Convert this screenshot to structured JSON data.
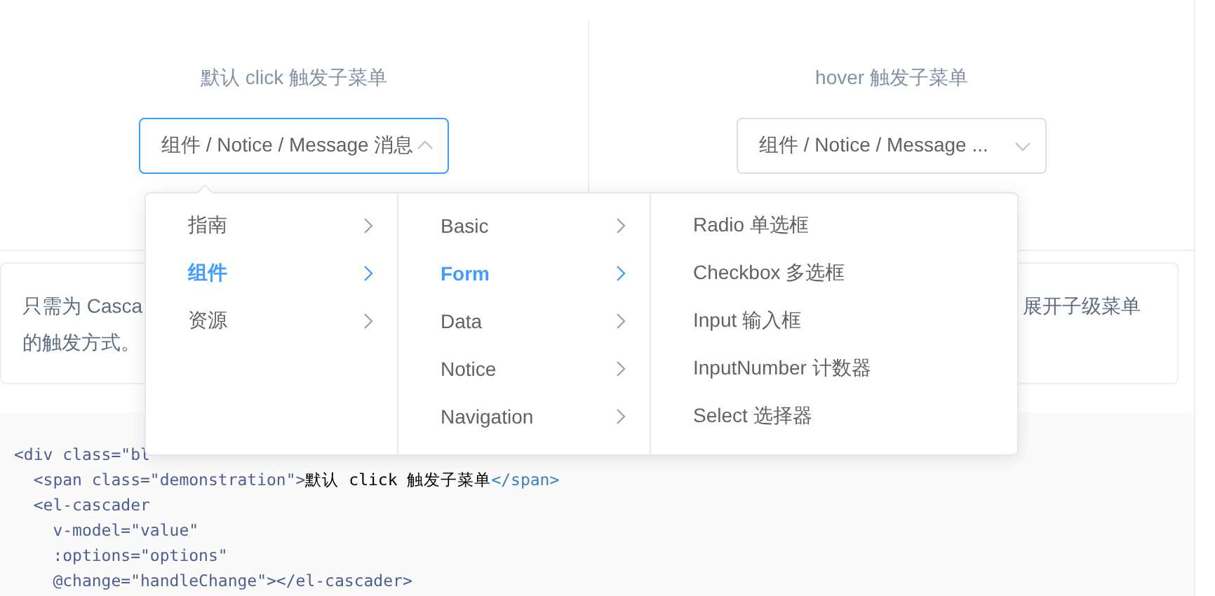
{
  "demos": [
    {
      "label": "默认 click 触发子菜单",
      "value": "组件 / Notice / Message 消息",
      "focused": true,
      "expanded": true
    },
    {
      "label": "hover 触发子菜单",
      "value": "组件 / Notice / Message ...",
      "focused": false,
      "expanded": false
    }
  ],
  "menu": {
    "columns": [
      [
        {
          "label": "指南",
          "selected": false,
          "has_children": true
        },
        {
          "label": "组件",
          "selected": true,
          "has_children": true
        },
        {
          "label": "资源",
          "selected": false,
          "has_children": true
        }
      ],
      [
        {
          "label": "Basic",
          "selected": false,
          "has_children": true
        },
        {
          "label": "Form",
          "selected": true,
          "has_children": true
        },
        {
          "label": "Data",
          "selected": false,
          "has_children": true
        },
        {
          "label": "Notice",
          "selected": false,
          "has_children": true
        },
        {
          "label": "Navigation",
          "selected": false,
          "has_children": true
        }
      ],
      [
        {
          "label": "Radio 单选框",
          "selected": false,
          "has_children": false
        },
        {
          "label": "Checkbox 多选框",
          "selected": false,
          "has_children": false
        },
        {
          "label": "Input 输入框",
          "selected": false,
          "has_children": false
        },
        {
          "label": "InputNumber 计数器",
          "selected": false,
          "has_children": false
        },
        {
          "label": "Select 选择器",
          "selected": false,
          "has_children": false
        }
      ]
    ]
  },
  "description": {
    "line_1_start": "只需为 Casca",
    "line_1_end": "展开子级菜单",
    "line_2": "的触发方式。"
  },
  "code": [
    [
      {
        "kind": "markup",
        "text": "<div class=\"bl"
      }
    ],
    [
      {
        "kind": "markup",
        "text": "  <span class=\"demonstration\">"
      },
      {
        "kind": "content",
        "text": "默认 click 触发子菜单"
      },
      {
        "kind": "tag",
        "text": "</span>"
      }
    ],
    [
      {
        "kind": "markup",
        "text": "  <el-cascader"
      }
    ],
    [
      {
        "kind": "markup",
        "text": "    v-model=\"value\""
      }
    ],
    [
      {
        "kind": "markup",
        "text": "    :options=\"options\""
      }
    ],
    [
      {
        "kind": "markup",
        "text": "    @change=\"handleChange\"></el-cascader>"
      }
    ]
  ]
}
